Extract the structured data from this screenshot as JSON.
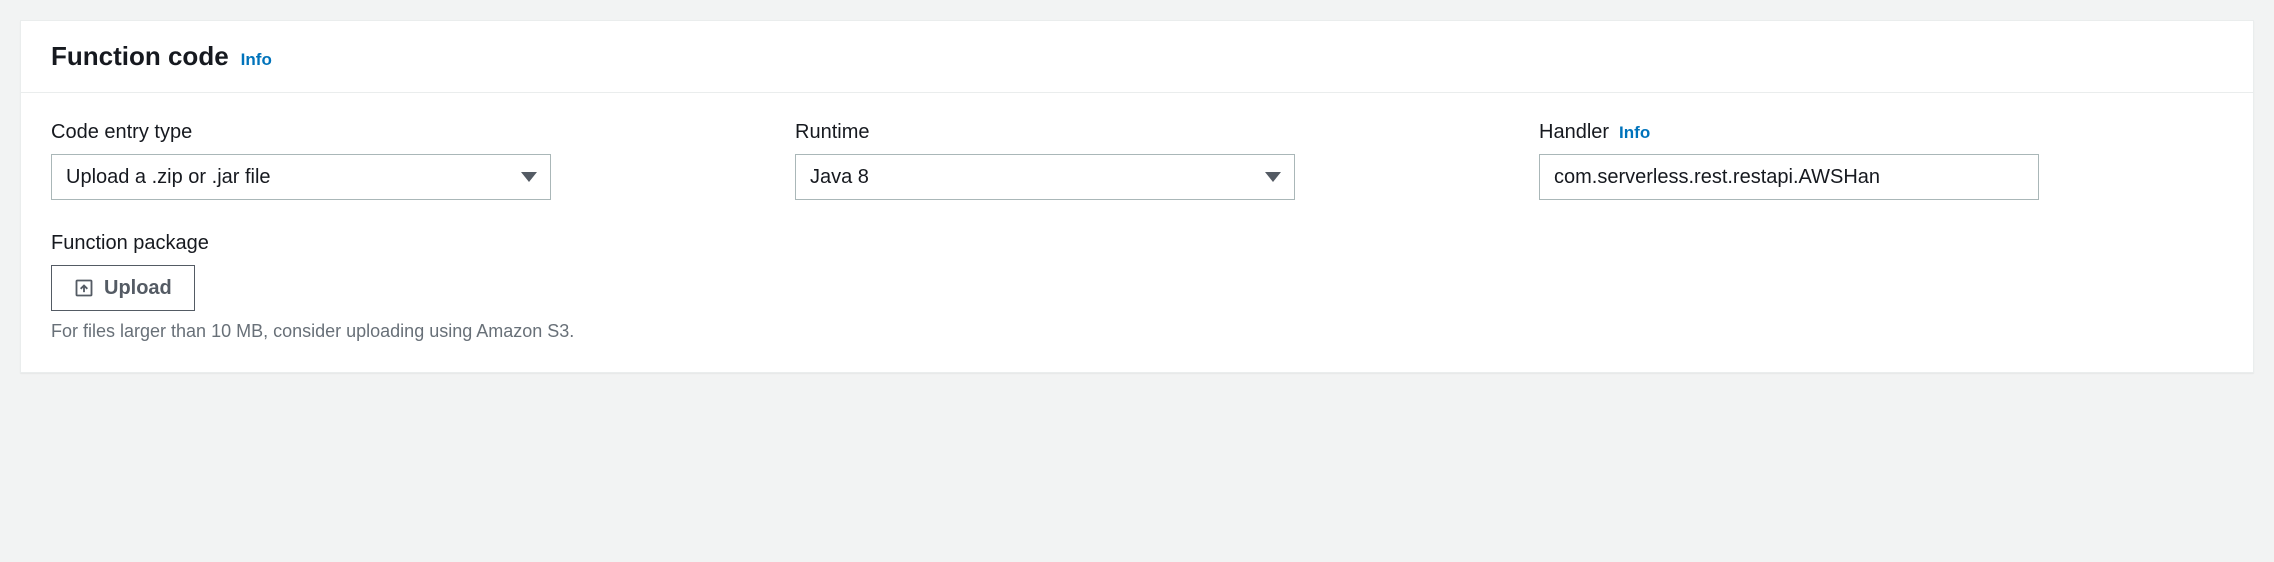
{
  "header": {
    "title": "Function code",
    "info": "Info"
  },
  "fields": {
    "codeEntryType": {
      "label": "Code entry type",
      "value": "Upload a .zip or .jar file"
    },
    "runtime": {
      "label": "Runtime",
      "value": "Java 8"
    },
    "handler": {
      "label": "Handler",
      "info": "Info",
      "value": "com.serverless.rest.restapi.AWSHan"
    }
  },
  "package": {
    "label": "Function package",
    "uploadLabel": "Upload",
    "hint": "For files larger than 10 MB, consider uploading using Amazon S3."
  }
}
